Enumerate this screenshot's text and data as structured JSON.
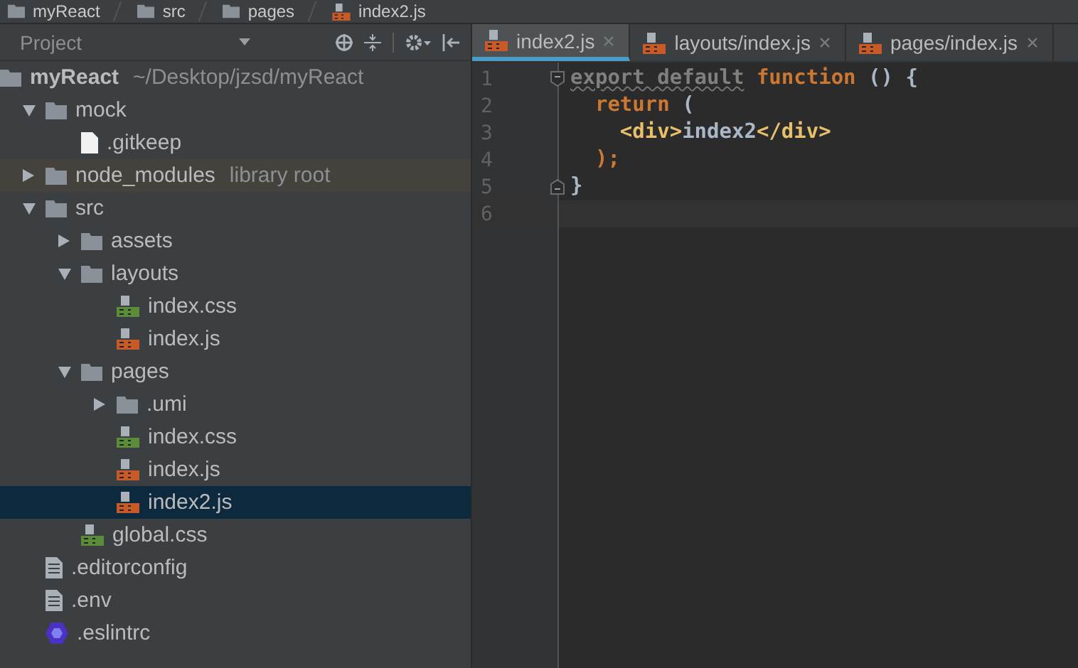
{
  "breadcrumb": [
    {
      "label": "myReact",
      "kind": "folder"
    },
    {
      "label": "src",
      "kind": "folder"
    },
    {
      "label": "pages",
      "kind": "folder"
    },
    {
      "label": "index2.js",
      "kind": "js"
    }
  ],
  "project_panel": {
    "title": "Project"
  },
  "tree": [
    {
      "label": "myReact",
      "hint": "~/Desktop/jzsd/myReact",
      "kind": "root",
      "selected": false,
      "children": [
        {
          "label": "mock",
          "kind": "folder",
          "expanded": true,
          "selected": false,
          "children": [
            {
              "label": ".gitkeep",
              "kind": "file",
              "selected": false
            }
          ]
        },
        {
          "label": "node_modules",
          "hint": "library root",
          "kind": "library",
          "expanded": false,
          "selected": false
        },
        {
          "label": "src",
          "kind": "folder",
          "expanded": true,
          "selected": false,
          "children": [
            {
              "label": "assets",
              "kind": "folder",
              "expanded": false,
              "selected": false
            },
            {
              "label": "layouts",
              "kind": "folder",
              "expanded": true,
              "selected": false,
              "children": [
                {
                  "label": "index.css",
                  "kind": "css",
                  "selected": false
                },
                {
                  "label": "index.js",
                  "kind": "js",
                  "selected": false
                }
              ]
            },
            {
              "label": "pages",
              "kind": "folder",
              "expanded": true,
              "selected": false,
              "children": [
                {
                  "label": ".umi",
                  "kind": "folder",
                  "expanded": false,
                  "selected": false
                },
                {
                  "label": "index.css",
                  "kind": "css",
                  "selected": false
                },
                {
                  "label": "index.js",
                  "kind": "js",
                  "selected": false
                },
                {
                  "label": "index2.js",
                  "kind": "js",
                  "selected": true
                }
              ]
            },
            {
              "label": "global.css",
              "kind": "css",
              "selected": false
            }
          ]
        },
        {
          "label": ".editorconfig",
          "kind": "text",
          "selected": false
        },
        {
          "label": ".env",
          "kind": "text",
          "selected": false
        },
        {
          "label": ".eslintrc",
          "kind": "eslint",
          "selected": false
        }
      ]
    }
  ],
  "tabs": [
    {
      "label": "index2.js",
      "selected": true
    },
    {
      "label": "layouts/index.js",
      "selected": false
    },
    {
      "label": "pages/index.js",
      "selected": false
    }
  ],
  "code": [
    {
      "number": "1",
      "fold_start": true,
      "current": false,
      "tokens": [
        {
          "text": "export default",
          "kind": "unused"
        },
        {
          "text": " function",
          "kind": "keyword"
        },
        {
          "text": " () {",
          "kind": "plain"
        }
      ]
    },
    {
      "number": "2",
      "current": false,
      "tokens": [
        {
          "text": "  return",
          "kind": "keyword"
        },
        {
          "text": " (",
          "kind": "plain"
        }
      ]
    },
    {
      "number": "3",
      "current": false,
      "tokens": [
        {
          "text": "    <div>",
          "kind": "tag"
        },
        {
          "text": "index2",
          "kind": "plain"
        },
        {
          "text": "</div>",
          "kind": "tag"
        }
      ]
    },
    {
      "number": "4",
      "current": false,
      "tokens": [
        {
          "text": "  );",
          "kind": "keyword"
        }
      ]
    },
    {
      "number": "5",
      "fold_end": true,
      "current": false,
      "tokens": [
        {
          "text": "}",
          "kind": "plain"
        }
      ]
    },
    {
      "number": "6",
      "current": true
    }
  ]
}
